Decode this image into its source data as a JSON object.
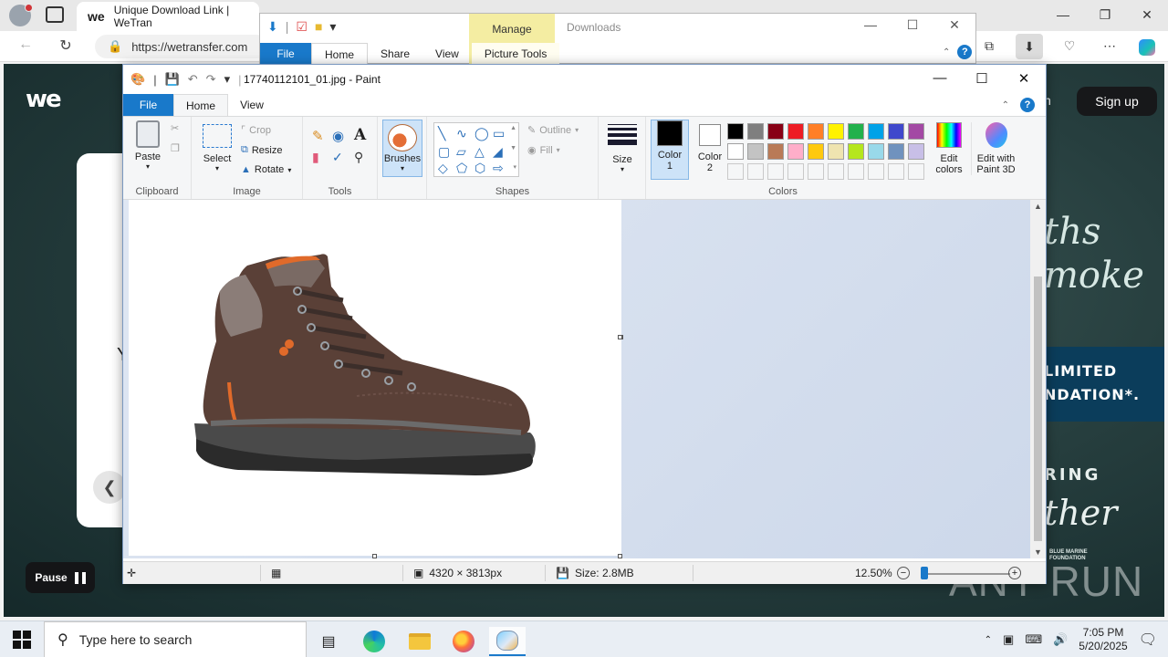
{
  "browser": {
    "tab_title": "Unique Download Link | WeTran",
    "tab_favicon": "we",
    "url": "https://wetransfer.com"
  },
  "webpage": {
    "logo": "we",
    "login_partial": "n",
    "signup": "Sign up",
    "card_partial": "Y",
    "ad_line1": "ths",
    "ad_line2": "moke",
    "ad_band_line1": "LIMITED",
    "ad_band_line2": "NDATION*.",
    "ad_line3": "RING",
    "ad_line4": "ther",
    "ad_brand_line1": "BLUE MARINE",
    "ad_brand_line2": "FOUNDATION",
    "pause": "Pause",
    "watermark": "ANY RUN"
  },
  "explorer": {
    "manage": "Manage",
    "downloads": "Downloads",
    "tabs": [
      "File",
      "Home",
      "Share",
      "View",
      "Picture Tools"
    ]
  },
  "paint": {
    "title": "17740112101_01.jpg - Paint",
    "tabs": {
      "file": "File",
      "home": "Home",
      "view": "View"
    },
    "ribbon": {
      "clipboard": {
        "paste": "Paste",
        "label": "Clipboard"
      },
      "image": {
        "select": "Select",
        "crop": "Crop",
        "resize": "Resize",
        "rotate": "Rotate",
        "label": "Image"
      },
      "tools": {
        "label": "Tools"
      },
      "brushes": "Brushes",
      "shapes": {
        "outline": "Outline",
        "fill": "Fill",
        "label": "Shapes"
      },
      "size": "Size",
      "color1": "Color\n1",
      "color1_a": "Color",
      "color1_b": "1",
      "color2_a": "Color",
      "color2_b": "2",
      "colors_label": "Colors",
      "edit_colors_a": "Edit",
      "edit_colors_b": "colors",
      "paint3d_a": "Edit with",
      "paint3d_b": "Paint 3D"
    },
    "palette": [
      "#000000",
      "#7f7f7f",
      "#880015",
      "#ed1c24",
      "#ff7f27",
      "#fff200",
      "#22b14c",
      "#00a2e8",
      "#3f48cc",
      "#a349a4",
      "#ffffff",
      "#c3c3c3",
      "#b97a57",
      "#ffaec9",
      "#ffc90e",
      "#efe4b0",
      "#b5e61d",
      "#99d9ea",
      "#7092be",
      "#c8bfe7"
    ],
    "color1_value": "#000000",
    "color2_value": "#ffffff",
    "status": {
      "dimensions": "4320 × 3813px",
      "size": "Size: 2.8MB",
      "zoom": "12.50%"
    }
  },
  "taskbar": {
    "search_placeholder": "Type here to search",
    "time": "7:05 PM",
    "date": "5/20/2025"
  }
}
